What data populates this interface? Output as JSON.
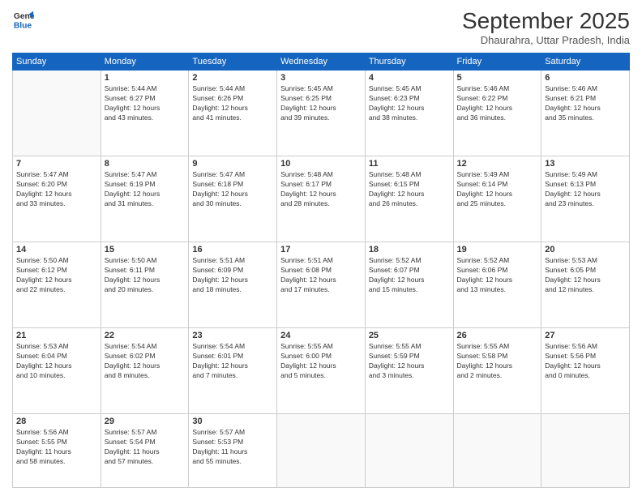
{
  "logo": {
    "line1": "General",
    "line2": "Blue"
  },
  "title": "September 2025",
  "subtitle": "Dhaurahra, Uttar Pradesh, India",
  "weekdays": [
    "Sunday",
    "Monday",
    "Tuesday",
    "Wednesday",
    "Thursday",
    "Friday",
    "Saturday"
  ],
  "weeks": [
    [
      {
        "day": "",
        "info": ""
      },
      {
        "day": "1",
        "info": "Sunrise: 5:44 AM\nSunset: 6:27 PM\nDaylight: 12 hours\nand 43 minutes."
      },
      {
        "day": "2",
        "info": "Sunrise: 5:44 AM\nSunset: 6:26 PM\nDaylight: 12 hours\nand 41 minutes."
      },
      {
        "day": "3",
        "info": "Sunrise: 5:45 AM\nSunset: 6:25 PM\nDaylight: 12 hours\nand 39 minutes."
      },
      {
        "day": "4",
        "info": "Sunrise: 5:45 AM\nSunset: 6:23 PM\nDaylight: 12 hours\nand 38 minutes."
      },
      {
        "day": "5",
        "info": "Sunrise: 5:46 AM\nSunset: 6:22 PM\nDaylight: 12 hours\nand 36 minutes."
      },
      {
        "day": "6",
        "info": "Sunrise: 5:46 AM\nSunset: 6:21 PM\nDaylight: 12 hours\nand 35 minutes."
      }
    ],
    [
      {
        "day": "7",
        "info": "Sunrise: 5:47 AM\nSunset: 6:20 PM\nDaylight: 12 hours\nand 33 minutes."
      },
      {
        "day": "8",
        "info": "Sunrise: 5:47 AM\nSunset: 6:19 PM\nDaylight: 12 hours\nand 31 minutes."
      },
      {
        "day": "9",
        "info": "Sunrise: 5:47 AM\nSunset: 6:18 PM\nDaylight: 12 hours\nand 30 minutes."
      },
      {
        "day": "10",
        "info": "Sunrise: 5:48 AM\nSunset: 6:17 PM\nDaylight: 12 hours\nand 28 minutes."
      },
      {
        "day": "11",
        "info": "Sunrise: 5:48 AM\nSunset: 6:15 PM\nDaylight: 12 hours\nand 26 minutes."
      },
      {
        "day": "12",
        "info": "Sunrise: 5:49 AM\nSunset: 6:14 PM\nDaylight: 12 hours\nand 25 minutes."
      },
      {
        "day": "13",
        "info": "Sunrise: 5:49 AM\nSunset: 6:13 PM\nDaylight: 12 hours\nand 23 minutes."
      }
    ],
    [
      {
        "day": "14",
        "info": "Sunrise: 5:50 AM\nSunset: 6:12 PM\nDaylight: 12 hours\nand 22 minutes."
      },
      {
        "day": "15",
        "info": "Sunrise: 5:50 AM\nSunset: 6:11 PM\nDaylight: 12 hours\nand 20 minutes."
      },
      {
        "day": "16",
        "info": "Sunrise: 5:51 AM\nSunset: 6:09 PM\nDaylight: 12 hours\nand 18 minutes."
      },
      {
        "day": "17",
        "info": "Sunrise: 5:51 AM\nSunset: 6:08 PM\nDaylight: 12 hours\nand 17 minutes."
      },
      {
        "day": "18",
        "info": "Sunrise: 5:52 AM\nSunset: 6:07 PM\nDaylight: 12 hours\nand 15 minutes."
      },
      {
        "day": "19",
        "info": "Sunrise: 5:52 AM\nSunset: 6:06 PM\nDaylight: 12 hours\nand 13 minutes."
      },
      {
        "day": "20",
        "info": "Sunrise: 5:53 AM\nSunset: 6:05 PM\nDaylight: 12 hours\nand 12 minutes."
      }
    ],
    [
      {
        "day": "21",
        "info": "Sunrise: 5:53 AM\nSunset: 6:04 PM\nDaylight: 12 hours\nand 10 minutes."
      },
      {
        "day": "22",
        "info": "Sunrise: 5:54 AM\nSunset: 6:02 PM\nDaylight: 12 hours\nand 8 minutes."
      },
      {
        "day": "23",
        "info": "Sunrise: 5:54 AM\nSunset: 6:01 PM\nDaylight: 12 hours\nand 7 minutes."
      },
      {
        "day": "24",
        "info": "Sunrise: 5:55 AM\nSunset: 6:00 PM\nDaylight: 12 hours\nand 5 minutes."
      },
      {
        "day": "25",
        "info": "Sunrise: 5:55 AM\nSunset: 5:59 PM\nDaylight: 12 hours\nand 3 minutes."
      },
      {
        "day": "26",
        "info": "Sunrise: 5:55 AM\nSunset: 5:58 PM\nDaylight: 12 hours\nand 2 minutes."
      },
      {
        "day": "27",
        "info": "Sunrise: 5:56 AM\nSunset: 5:56 PM\nDaylight: 12 hours\nand 0 minutes."
      }
    ],
    [
      {
        "day": "28",
        "info": "Sunrise: 5:56 AM\nSunset: 5:55 PM\nDaylight: 11 hours\nand 58 minutes."
      },
      {
        "day": "29",
        "info": "Sunrise: 5:57 AM\nSunset: 5:54 PM\nDaylight: 11 hours\nand 57 minutes."
      },
      {
        "day": "30",
        "info": "Sunrise: 5:57 AM\nSunset: 5:53 PM\nDaylight: 11 hours\nand 55 minutes."
      },
      {
        "day": "",
        "info": ""
      },
      {
        "day": "",
        "info": ""
      },
      {
        "day": "",
        "info": ""
      },
      {
        "day": "",
        "info": ""
      }
    ]
  ]
}
